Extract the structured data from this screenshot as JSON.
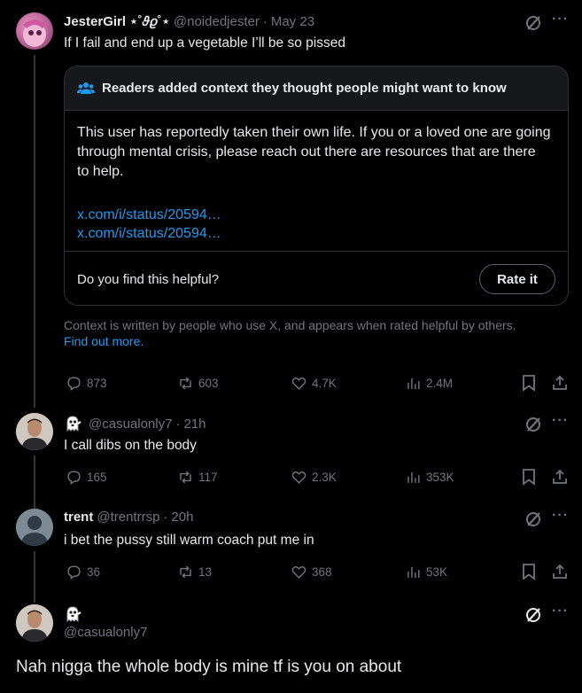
{
  "tweets": [
    {
      "display_name": "JesterGirl ⋆˚𝜗𝜚˚⋆",
      "handle": "@noidedjester",
      "date": "May 23",
      "text": "If I fail and end up a vegetable I’ll be so pissed",
      "replies": "873",
      "reposts": "603",
      "likes": "4.7K",
      "views": "2.4M"
    },
    {
      "display_name": "",
      "handle": "@casualonly7",
      "date": "21h",
      "text": "I call dibs on the body",
      "replies": "165",
      "reposts": "117",
      "likes": "2.3K",
      "views": "353K"
    },
    {
      "display_name": "trent",
      "handle": "@trentrrsp",
      "date": "20h",
      "text": "i bet the pussy still warm coach put me in",
      "replies": "36",
      "reposts": "13",
      "likes": "368",
      "views": "53K"
    },
    {
      "display_name": "",
      "handle": "@casualonly7",
      "text": "Nah nigga the whole body is mine tf is you on about"
    }
  ],
  "community_note": {
    "header": "Readers added context they thought people might want to know",
    "body": "This user has reportedly taken their own life. If you or a loved one are going through mental crisis, please reach out there are resources that are there to help.",
    "links": [
      "x.com/i/status/20594…",
      "x.com/i/status/20594…"
    ],
    "question": "Do you find this helpful?",
    "rate_label": "Rate it",
    "footer_text": "Context is written by people who use X, and appears when rated helpful by others.",
    "find_out_more": "Find out more."
  },
  "separator": "·",
  "colors": {
    "background": "#000000",
    "text": "#e7e9ea",
    "muted": "#71767b",
    "link": "#1d9bf0",
    "border": "#2f3336"
  }
}
